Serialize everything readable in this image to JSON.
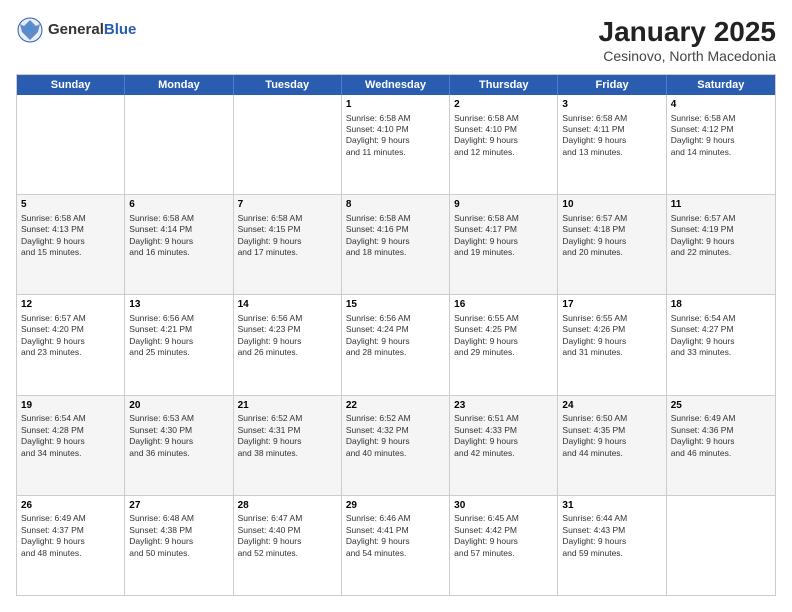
{
  "header": {
    "logo_general": "General",
    "logo_blue": "Blue",
    "title": "January 2025",
    "location": "Cesinovo, North Macedonia"
  },
  "weekdays": [
    "Sunday",
    "Monday",
    "Tuesday",
    "Wednesday",
    "Thursday",
    "Friday",
    "Saturday"
  ],
  "rows": [
    {
      "alt": false,
      "cells": [
        {
          "day": "",
          "text": ""
        },
        {
          "day": "",
          "text": ""
        },
        {
          "day": "",
          "text": ""
        },
        {
          "day": "1",
          "text": "Sunrise: 6:58 AM\nSunset: 4:10 PM\nDaylight: 9 hours\nand 11 minutes."
        },
        {
          "day": "2",
          "text": "Sunrise: 6:58 AM\nSunset: 4:10 PM\nDaylight: 9 hours\nand 12 minutes."
        },
        {
          "day": "3",
          "text": "Sunrise: 6:58 AM\nSunset: 4:11 PM\nDaylight: 9 hours\nand 13 minutes."
        },
        {
          "day": "4",
          "text": "Sunrise: 6:58 AM\nSunset: 4:12 PM\nDaylight: 9 hours\nand 14 minutes."
        }
      ]
    },
    {
      "alt": true,
      "cells": [
        {
          "day": "5",
          "text": "Sunrise: 6:58 AM\nSunset: 4:13 PM\nDaylight: 9 hours\nand 15 minutes."
        },
        {
          "day": "6",
          "text": "Sunrise: 6:58 AM\nSunset: 4:14 PM\nDaylight: 9 hours\nand 16 minutes."
        },
        {
          "day": "7",
          "text": "Sunrise: 6:58 AM\nSunset: 4:15 PM\nDaylight: 9 hours\nand 17 minutes."
        },
        {
          "day": "8",
          "text": "Sunrise: 6:58 AM\nSunset: 4:16 PM\nDaylight: 9 hours\nand 18 minutes."
        },
        {
          "day": "9",
          "text": "Sunrise: 6:58 AM\nSunset: 4:17 PM\nDaylight: 9 hours\nand 19 minutes."
        },
        {
          "day": "10",
          "text": "Sunrise: 6:57 AM\nSunset: 4:18 PM\nDaylight: 9 hours\nand 20 minutes."
        },
        {
          "day": "11",
          "text": "Sunrise: 6:57 AM\nSunset: 4:19 PM\nDaylight: 9 hours\nand 22 minutes."
        }
      ]
    },
    {
      "alt": false,
      "cells": [
        {
          "day": "12",
          "text": "Sunrise: 6:57 AM\nSunset: 4:20 PM\nDaylight: 9 hours\nand 23 minutes."
        },
        {
          "day": "13",
          "text": "Sunrise: 6:56 AM\nSunset: 4:21 PM\nDaylight: 9 hours\nand 25 minutes."
        },
        {
          "day": "14",
          "text": "Sunrise: 6:56 AM\nSunset: 4:23 PM\nDaylight: 9 hours\nand 26 minutes."
        },
        {
          "day": "15",
          "text": "Sunrise: 6:56 AM\nSunset: 4:24 PM\nDaylight: 9 hours\nand 28 minutes."
        },
        {
          "day": "16",
          "text": "Sunrise: 6:55 AM\nSunset: 4:25 PM\nDaylight: 9 hours\nand 29 minutes."
        },
        {
          "day": "17",
          "text": "Sunrise: 6:55 AM\nSunset: 4:26 PM\nDaylight: 9 hours\nand 31 minutes."
        },
        {
          "day": "18",
          "text": "Sunrise: 6:54 AM\nSunset: 4:27 PM\nDaylight: 9 hours\nand 33 minutes."
        }
      ]
    },
    {
      "alt": true,
      "cells": [
        {
          "day": "19",
          "text": "Sunrise: 6:54 AM\nSunset: 4:28 PM\nDaylight: 9 hours\nand 34 minutes."
        },
        {
          "day": "20",
          "text": "Sunrise: 6:53 AM\nSunset: 4:30 PM\nDaylight: 9 hours\nand 36 minutes."
        },
        {
          "day": "21",
          "text": "Sunrise: 6:52 AM\nSunset: 4:31 PM\nDaylight: 9 hours\nand 38 minutes."
        },
        {
          "day": "22",
          "text": "Sunrise: 6:52 AM\nSunset: 4:32 PM\nDaylight: 9 hours\nand 40 minutes."
        },
        {
          "day": "23",
          "text": "Sunrise: 6:51 AM\nSunset: 4:33 PM\nDaylight: 9 hours\nand 42 minutes."
        },
        {
          "day": "24",
          "text": "Sunrise: 6:50 AM\nSunset: 4:35 PM\nDaylight: 9 hours\nand 44 minutes."
        },
        {
          "day": "25",
          "text": "Sunrise: 6:49 AM\nSunset: 4:36 PM\nDaylight: 9 hours\nand 46 minutes."
        }
      ]
    },
    {
      "alt": false,
      "cells": [
        {
          "day": "26",
          "text": "Sunrise: 6:49 AM\nSunset: 4:37 PM\nDaylight: 9 hours\nand 48 minutes."
        },
        {
          "day": "27",
          "text": "Sunrise: 6:48 AM\nSunset: 4:38 PM\nDaylight: 9 hours\nand 50 minutes."
        },
        {
          "day": "28",
          "text": "Sunrise: 6:47 AM\nSunset: 4:40 PM\nDaylight: 9 hours\nand 52 minutes."
        },
        {
          "day": "29",
          "text": "Sunrise: 6:46 AM\nSunset: 4:41 PM\nDaylight: 9 hours\nand 54 minutes."
        },
        {
          "day": "30",
          "text": "Sunrise: 6:45 AM\nSunset: 4:42 PM\nDaylight: 9 hours\nand 57 minutes."
        },
        {
          "day": "31",
          "text": "Sunrise: 6:44 AM\nSunset: 4:43 PM\nDaylight: 9 hours\nand 59 minutes."
        },
        {
          "day": "",
          "text": ""
        }
      ]
    }
  ]
}
